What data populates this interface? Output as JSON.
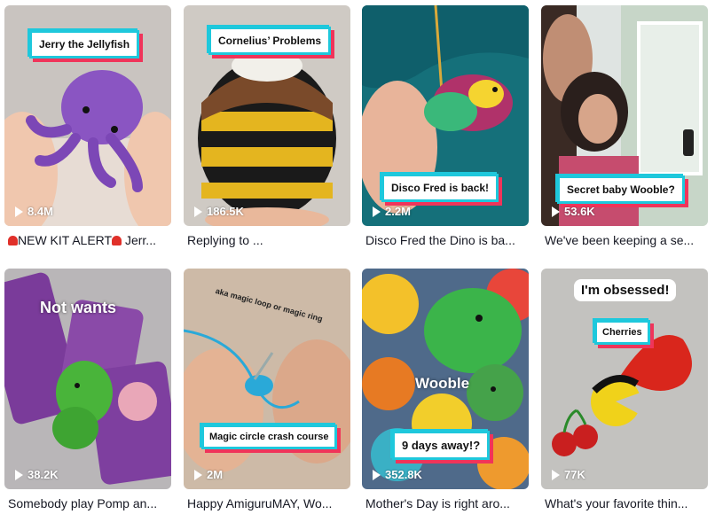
{
  "videos": [
    {
      "overlay": "Jerry the Jellyfish",
      "views": "8.4M",
      "caption": "NEW KIT ALERT",
      "caption_tail": " Jerr...",
      "icon": "siren-icon"
    },
    {
      "overlay": "Cornelius’ Problems",
      "views": "186.5K",
      "caption": "Replying to ..."
    },
    {
      "overlay": "Disco Fred is back!",
      "views": "2.2M",
      "caption": "Disco Fred the Dino is ba..."
    },
    {
      "overlay": "Secret baby Wooble?",
      "views": "53.6K",
      "caption": "We've been keeping a se..."
    },
    {
      "overlay": "Not wants",
      "views": "38.2K",
      "caption": "Somebody play Pomp an..."
    },
    {
      "overlay": "Magic circle crash course",
      "overlay_small": "aka magic loop or magic ring",
      "views": "2M",
      "caption": "Happy AmiguruMAY, Wo..."
    },
    {
      "overlay": "9 days away!?",
      "overlay_big": "Wooble",
      "views": "352.8K",
      "caption": "Mother's Day is right aro..."
    },
    {
      "overlay": "Cherries",
      "overlay_top": "I'm obsessed!",
      "views": "77K",
      "caption": "What's your favorite thin..."
    }
  ]
}
